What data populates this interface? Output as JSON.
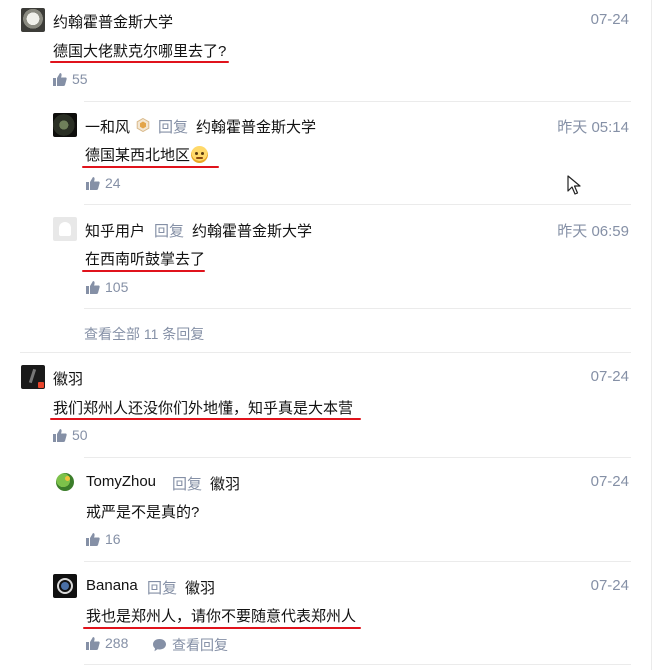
{
  "comments": [
    {
      "author": "约翰霍普金斯大学",
      "time": "07-24",
      "text": "德国大佬默克尔哪里去了?",
      "likes": "55",
      "avatar_icon": "avatar-yhopkins",
      "replies": [
        {
          "author": "一和风",
          "badge_icon": "hexagon-badge-icon",
          "reply_word": "回复",
          "reply_to": "约翰霍普金斯大学",
          "time": "昨天 05:14",
          "text": "德国某西北地区",
          "emoji": "smile-emoji-icon",
          "likes": "24"
        },
        {
          "author": "知乎用户",
          "reply_word": "回复",
          "reply_to": "约翰霍普金斯大学",
          "time": "昨天 06:59",
          "text": "在西南听鼓掌去了",
          "likes": "105"
        }
      ],
      "view_all": "查看全部 11 条回复"
    },
    {
      "author": "徽羽",
      "time": "07-24",
      "text": "我们郑州人还没你们外地懂，知乎真是大本营",
      "likes": "50",
      "replies": [
        {
          "author": "TomyZhou",
          "reply_word": "回复",
          "reply_to": "徽羽",
          "time": "07-24",
          "text": "戒严是不是真的?",
          "likes": "16"
        },
        {
          "author": "Banana",
          "reply_word": "回复",
          "reply_to": "徽羽",
          "time": "07-24",
          "text": "我也是郑州人，请你不要随意代表郑州人",
          "likes": "288",
          "view_replies": "查看回复"
        }
      ]
    }
  ],
  "colors": {
    "muted": "#8590a6",
    "underline": "#e0131c",
    "divider": "#ebebeb"
  }
}
